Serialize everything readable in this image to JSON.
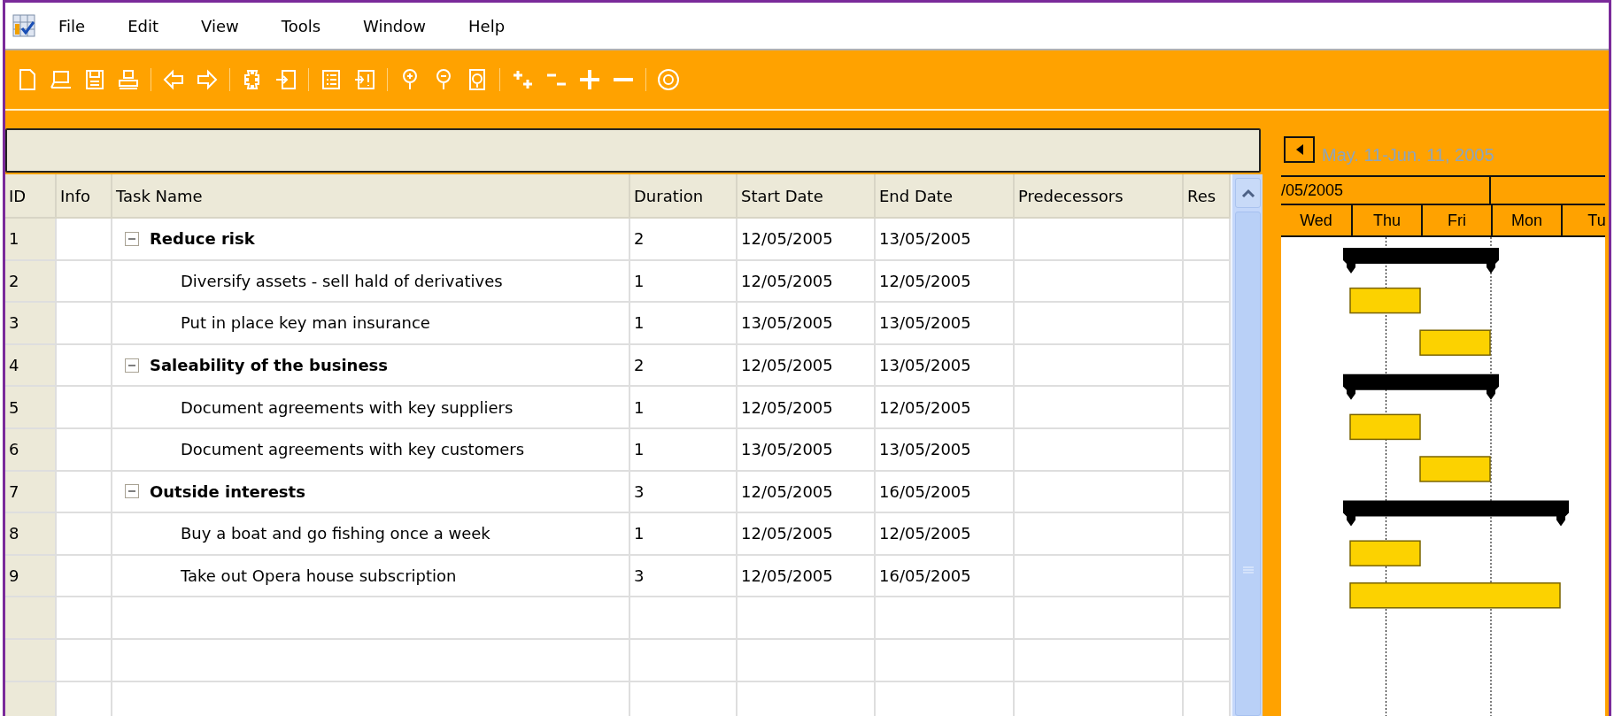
{
  "menu": [
    "File",
    "Edit",
    "View",
    "Tools",
    "Window",
    "Help"
  ],
  "columns": [
    "ID",
    "Info",
    "Task Name",
    "Duration",
    "Start Date",
    "End Date",
    "Predecessors",
    "Res"
  ],
  "rows": [
    {
      "id": "1",
      "kind": "summary",
      "expanded": true,
      "name": "Reduce risk",
      "duration": "2",
      "start": "12/05/2005",
      "end": "13/05/2005"
    },
    {
      "id": "2",
      "kind": "task",
      "name": "Diversify assets - sell hald of derivatives",
      "duration": "1",
      "start": "12/05/2005",
      "end": "12/05/2005"
    },
    {
      "id": "3",
      "kind": "task",
      "name": "Put in place key man insurance",
      "duration": "1",
      "start": "13/05/2005",
      "end": "13/05/2005"
    },
    {
      "id": "4",
      "kind": "summary",
      "expanded": true,
      "name": "Saleability of the business",
      "duration": "2",
      "start": "12/05/2005",
      "end": "13/05/2005"
    },
    {
      "id": "5",
      "kind": "task",
      "name": "Document agreements with key suppliers",
      "duration": "1",
      "start": "12/05/2005",
      "end": "12/05/2005"
    },
    {
      "id": "6",
      "kind": "task",
      "name": "Document agreements with key customers",
      "duration": "1",
      "start": "13/05/2005",
      "end": "13/05/2005"
    },
    {
      "id": "7",
      "kind": "summary",
      "expanded": true,
      "name": "Outside interests",
      "duration": "3",
      "start": "12/05/2005",
      "end": "16/05/2005"
    },
    {
      "id": "8",
      "kind": "task",
      "name": "Buy a boat and go fishing once a week",
      "duration": "1",
      "start": "12/05/2005",
      "end": "12/05/2005"
    },
    {
      "id": "9",
      "kind": "task",
      "name": "Take out Opera house subscription",
      "duration": "3",
      "start": "12/05/2005",
      "end": "16/05/2005"
    }
  ],
  "gantt": {
    "range": "May. 11-Jun. 11, 2005",
    "week": "/05/2005",
    "days": [
      "Wed",
      "Thu",
      "Fri",
      "Mon",
      "Tu"
    ]
  }
}
